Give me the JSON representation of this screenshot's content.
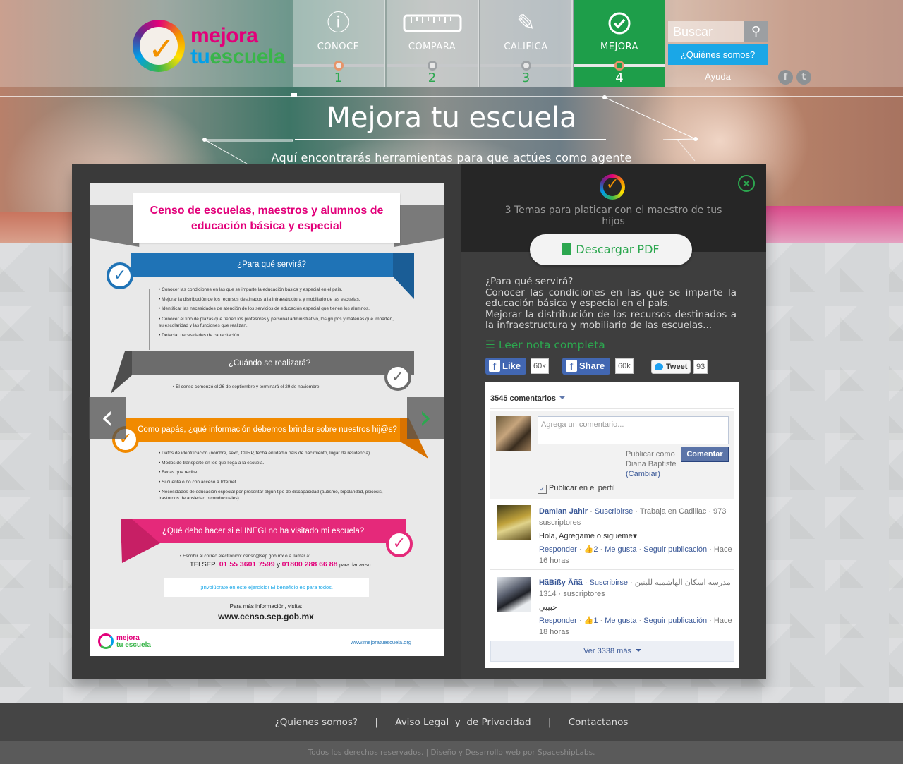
{
  "brand": {
    "line1": "mejora",
    "line2a": "tu",
    "line2b": "escuela"
  },
  "steps": [
    {
      "label": "CONOCE",
      "num": "1",
      "icon": "info-icon"
    },
    {
      "label": "COMPARA",
      "num": "2",
      "icon": "ruler-icon"
    },
    {
      "label": "CALIFICA",
      "num": "3",
      "icon": "pencil-icon"
    },
    {
      "label": "MEJORA",
      "num": "4",
      "icon": "check-circle-icon",
      "active": true
    }
  ],
  "search": {
    "placeholder": "Buscar"
  },
  "nav": {
    "quienes": "¿Quiénes somos?",
    "ayuda": "Ayuda"
  },
  "social": {
    "facebook": "f",
    "twitter": "t"
  },
  "hero": {
    "title": "Mejora tu escuela",
    "subtitle": "Aquí encontrarás herramientas para que actúes como agente"
  },
  "poster": {
    "title": "Censo de escuelas, maestros y alumnos de educación básica y especial",
    "q1": "¿Para qué servirá?",
    "q1_items": [
      "Conocer las condiciones en las que se imparte la educación básica y especial en el país.",
      "Mejorar la distribución de los recursos destinados a la infraestructura y mobiliario de las escuelas.",
      "Identificar las necesidades de atención de los servicios de educación especial que tienen los alumnos.",
      "Conocer el tipo de plazas que tienen los profesores y personal administrativo, los grupos y materias que imparten, su escolaridad y las funciones que realizan.",
      "Detectar necesidades de capacitación."
    ],
    "q2": "¿Cuándo se realizará?",
    "q2_items": [
      "El censo comenzó el 26 de septiembre y terminará el 29 de noviembre."
    ],
    "q3": "Como papás, ¿qué información debemos brindar sobre nuestros hij@s?",
    "q3_items": [
      "Datos de identificación (nombre, sexo, CURP, fecha entidad o país de nacimiento, lugar de residencia).",
      "Modos de transporte en los que llega a la escuela.",
      "Becas que recibe.",
      "Si cuenta o no con acceso a Internet.",
      "Necesidades de educación especial por presentar algún tipo de discapacidad (autismo, bipolaridad, psicosis, trastornos de ansiedad o conductuales)."
    ],
    "q4": "¿Qué debo hacer si el INEGI no ha visitado mi escuela?",
    "q4_items": [
      "Escribir al correo electrónico: censo@sep.gob.mx o a llamar a:"
    ],
    "telsep_label": "TELSEP",
    "tel1": "01 55 3601 7599",
    "tel_y": "y",
    "tel2": "01800 288 66 88",
    "tel_suffix": "para dar aviso.",
    "involucrate": "¡Involúcrate en este ejercicio! El beneficio es para todos.",
    "masinfo": "Para más información, visita:",
    "censo_url": "www.censo.sep.gob.mx",
    "foot_logo1": "mejora",
    "foot_logo2": "tu escuela",
    "foot_url": "www.mejoratuescuela.org"
  },
  "panel": {
    "subtitle": "3 Temas para platicar con el maestro de tus hijos",
    "pdf_label": "Descargar PDF",
    "text": "¿Para qué servirá?\nConocer las condiciones en las que se imparte la educación básica y especial en el país.\nMejorar la distribución de los recursos destinados a la infraestructura y mobiliario de las escuelas...",
    "leer": "Leer nota completa",
    "like_label": "Like",
    "like_count": "60k",
    "share_label": "Share",
    "share_count": "60k",
    "tweet_label": "Tweet",
    "tweet_count": "93"
  },
  "comments": {
    "count_label": "3545 comentarios",
    "placeholder": "Agrega un comentario...",
    "publicar_como": "Publicar como",
    "user": "Diana Baptiste",
    "cambiar": "(Cambiar)",
    "comentar": "Comentar",
    "perfil": "Publicar en el perfil",
    "items": [
      {
        "name": "Damian Jahir",
        "subscribe": "Suscribirse",
        "meta": "· Trabaja en Cadillac · 973 suscriptores",
        "text": "Hola, Agregame o sigueme♥",
        "responder": "Responder",
        "likes": "2",
        "megusta": "Me gusta",
        "seguir": "Seguir publicación",
        "time": "· Hace 16 horas"
      },
      {
        "name": "HãBißy Åñã",
        "subscribe": "Suscribirse",
        "meta": "· مدرسة اسكان الهاشمية للبنين · 1314 suscriptores",
        "text": "حبيبي",
        "responder": "Responder",
        "likes": "1",
        "megusta": "Me gusta",
        "seguir": "Seguir publicación",
        "time": "· Hace 18 horas"
      }
    ],
    "ver_mas": "Ver 3338 más"
  },
  "footer": {
    "link1": "¿Quienes somos?",
    "link2": "Aviso Legal  y  de Privacidad",
    "link3": "Contactanos",
    "sep": "|",
    "copyright": "Todos los derechos reservados. | Diseño y Desarrollo web por SpaceshipLabs."
  }
}
